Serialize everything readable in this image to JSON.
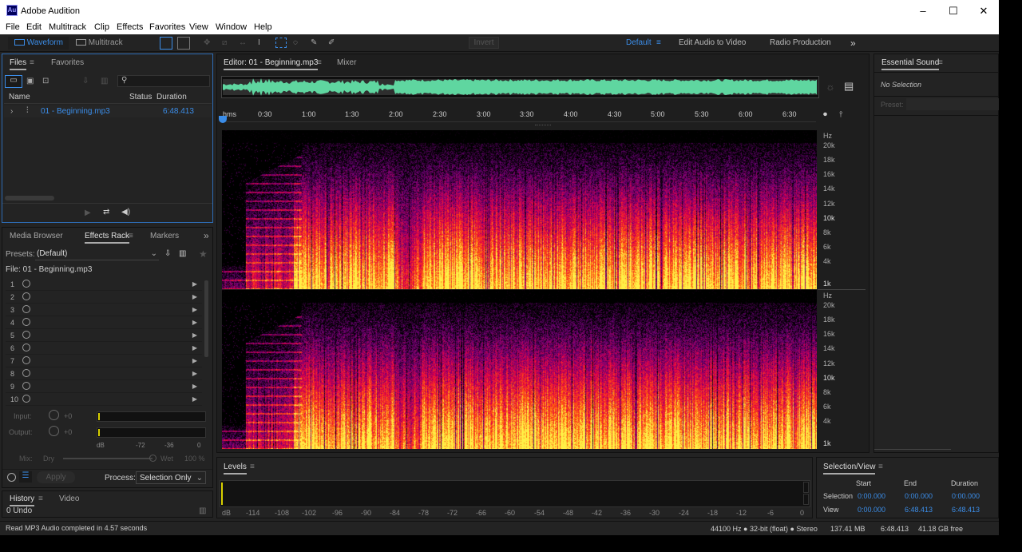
{
  "window": {
    "app_name": "Adobe Audition",
    "logo": "Au",
    "minimize": "–",
    "maximize": "☐",
    "close": "✕"
  },
  "menu": [
    "File",
    "Edit",
    "Multitrack",
    "Clip",
    "Effects",
    "Favorites",
    "View",
    "Window",
    "Help"
  ],
  "toolbar": {
    "waveform": "Waveform",
    "multitrack": "Multitrack",
    "invert": "Invert",
    "workspaces": [
      "Default",
      "Edit Audio to Video",
      "Radio Production"
    ],
    "more": "»"
  },
  "files_panel": {
    "tabs": [
      "Files",
      "Favorites"
    ],
    "columns": [
      "Name",
      "Status",
      "Duration"
    ],
    "items": [
      {
        "name": "01 - Beginning.mp3",
        "duration": "6:48.413"
      }
    ]
  },
  "effects_panel": {
    "tabs": [
      "Media Browser",
      "Effects Rack",
      "Markers"
    ],
    "presets_label": "Presets:",
    "presets_value": "(Default)",
    "file_label": "File: 01 - Beginning.mp3",
    "slots": [
      "1",
      "2",
      "3",
      "4",
      "5",
      "6",
      "7",
      "8",
      "9",
      "10"
    ],
    "input_label": "Input:",
    "input_value": "+0",
    "output_label": "Output:",
    "output_value": "+0",
    "meter_ticks": [
      "dB",
      "-72",
      "-36",
      "0"
    ],
    "mix_label": "Mix:",
    "dry_label": "Dry",
    "wet_label": "Wet",
    "wet_value": "100 %",
    "apply_label": "Apply",
    "process_label": "Process:",
    "process_value": "Selection Only"
  },
  "history_panel": {
    "tabs": [
      "History",
      "Video"
    ],
    "entry": "0 Undo"
  },
  "editor": {
    "tabs": [
      "Editor: 01 - Beginning.mp3",
      "Mixer"
    ],
    "time_unit": "hms",
    "time_ticks": [
      "0:30",
      "1:00",
      "1:30",
      "2:00",
      "2:30",
      "3:00",
      "3:30",
      "4:00",
      "4:30",
      "5:00",
      "5:30",
      "6:00",
      "6:30"
    ],
    "hz_unit": "Hz",
    "hz_ticks": [
      "20k",
      "18k",
      "16k",
      "14k",
      "12k",
      "10k",
      "8k",
      "6k",
      "4k",
      "1k"
    ]
  },
  "levels_panel": {
    "title": "Levels",
    "ticks": [
      "dB",
      "-114",
      "-108",
      "-102",
      "-96",
      "-90",
      "-84",
      "-78",
      "-72",
      "-66",
      "-60",
      "-54",
      "-48",
      "-42",
      "-36",
      "-30",
      "-24",
      "-18",
      "-12",
      "-6",
      "0"
    ]
  },
  "essential_sound": {
    "title": "Essential Sound",
    "no_selection": "No Selection",
    "preset_label": "Preset:"
  },
  "selection_view": {
    "title": "Selection/View",
    "headers": [
      "Start",
      "End",
      "Duration"
    ],
    "rows": [
      {
        "label": "Selection",
        "start": "0:00.000",
        "end": "0:00.000",
        "duration": "0:00.000"
      },
      {
        "label": "View",
        "start": "0:00.000",
        "end": "6:48.413",
        "duration": "6:48.413"
      }
    ]
  },
  "status_bar": {
    "message": "Read MP3 Audio completed in 4.57 seconds",
    "format": "44100 Hz ● 32-bit (float) ● Stereo",
    "size": "137.41 MB",
    "duration": "6:48.413",
    "free": "41.18 GB free"
  }
}
